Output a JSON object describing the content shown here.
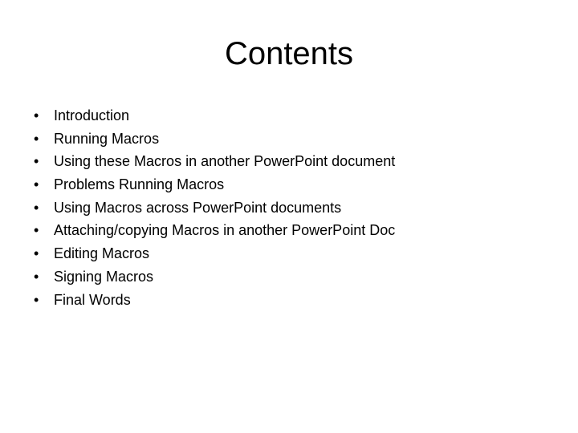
{
  "slide": {
    "title": "Contents",
    "background_color": "#ffffff",
    "text_color": "#000000",
    "bullet_glyph": "•",
    "items": [
      {
        "label": "Introduction"
      },
      {
        "label": "Running Macros"
      },
      {
        "label": "Using these Macros in another PowerPoint document"
      },
      {
        "label": "Problems Running Macros"
      },
      {
        "label": "Using Macros across PowerPoint documents"
      },
      {
        "label": "Attaching/copying Macros in another PowerPoint Doc"
      },
      {
        "label": "Editing Macros"
      },
      {
        "label": "Signing Macros"
      },
      {
        "label": "Final Words"
      }
    ]
  }
}
